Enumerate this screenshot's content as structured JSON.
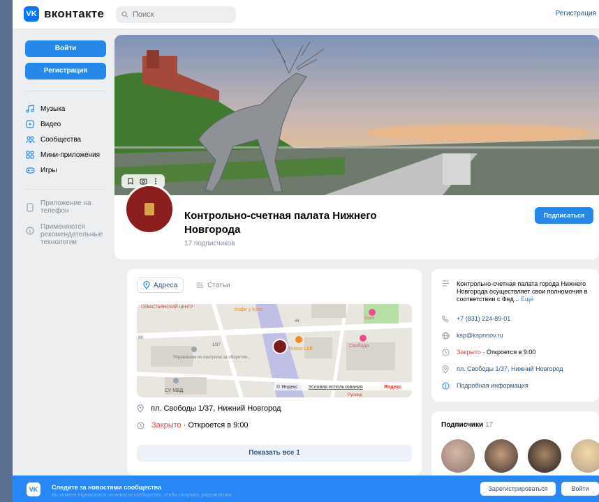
{
  "app": {
    "brand": "вконтакте",
    "logo_glyph": "VK",
    "accent": "#2688eb"
  },
  "topbar": {
    "search_placeholder": "Поиск",
    "register_link": "Регистрация"
  },
  "sidebar": {
    "login_label": "Войти",
    "register_label": "Регистрация",
    "items": [
      {
        "label": "Музыка",
        "icon": "music-icon"
      },
      {
        "label": "Видео",
        "icon": "video-icon"
      },
      {
        "label": "Сообщества",
        "icon": "communities-icon"
      },
      {
        "label": "Мини-приложения",
        "icon": "mini-apps-icon"
      },
      {
        "label": "Игры",
        "icon": "games-icon"
      }
    ],
    "phone_app": "Приложение на телефон",
    "recommend_note": "Применяются рекомендательные технологии"
  },
  "group": {
    "name": "Контрольно-счетная палата Нижнего Новгорода",
    "subscribers_text": "17 подписчиков",
    "subscribe_label": "Подписаться"
  },
  "info": {
    "tabs": [
      {
        "label": "Адреса",
        "icon": "location-icon",
        "active": true
      },
      {
        "label": "Статьи",
        "icon": "articles-icon",
        "active": false
      }
    ],
    "map": {
      "street_top": "Кофе у Кати",
      "center_top": "СЕВАСТЬЯНСКИЙ ЦЕНТР",
      "label_number1": "44",
      "label_number2": "86",
      "label_number3": "1/37",
      "place1": "Dzen",
      "place2": "Свобода",
      "place3": "Russo Loft",
      "place4": "Управление по контролю за оборотом...",
      "place5": "СУ МВД",
      "place6": "Русмед",
      "copyright": "© Яндекс",
      "terms": "Условия использования",
      "yandex": "Яндекс"
    },
    "address": "пл. Свободы 1/37, Нижний Новгород",
    "status_closed": "Закрыто",
    "status_separator": " · ",
    "status_opens": "Откроется в 9:00",
    "show_all_label": "Показать все 1"
  },
  "about": {
    "description": "Контрольно-счетная палата города Нижнего Новгорода осуществляет свои полномочия в соответствии с Фед...",
    "more_label": "Ещё",
    "phone": "+7 (831) 224-89-01",
    "website": "ksp@kspnnov.ru",
    "status_closed": "Закрыто",
    "status_opens": "· Откроется в 9:00",
    "address": "пл. Свободы 1/37, Нижний Новгород",
    "details": "Подробная информация"
  },
  "subscribers": {
    "title": "Подписчики",
    "count": "17"
  },
  "bottom_bar": {
    "text": "Следите за новостями сообщества",
    "subtext": "Вы можете подписаться на новости сообщества, чтобы получать уведомления",
    "register_label": "Зарегистрироваться",
    "login_label": "Войти"
  }
}
